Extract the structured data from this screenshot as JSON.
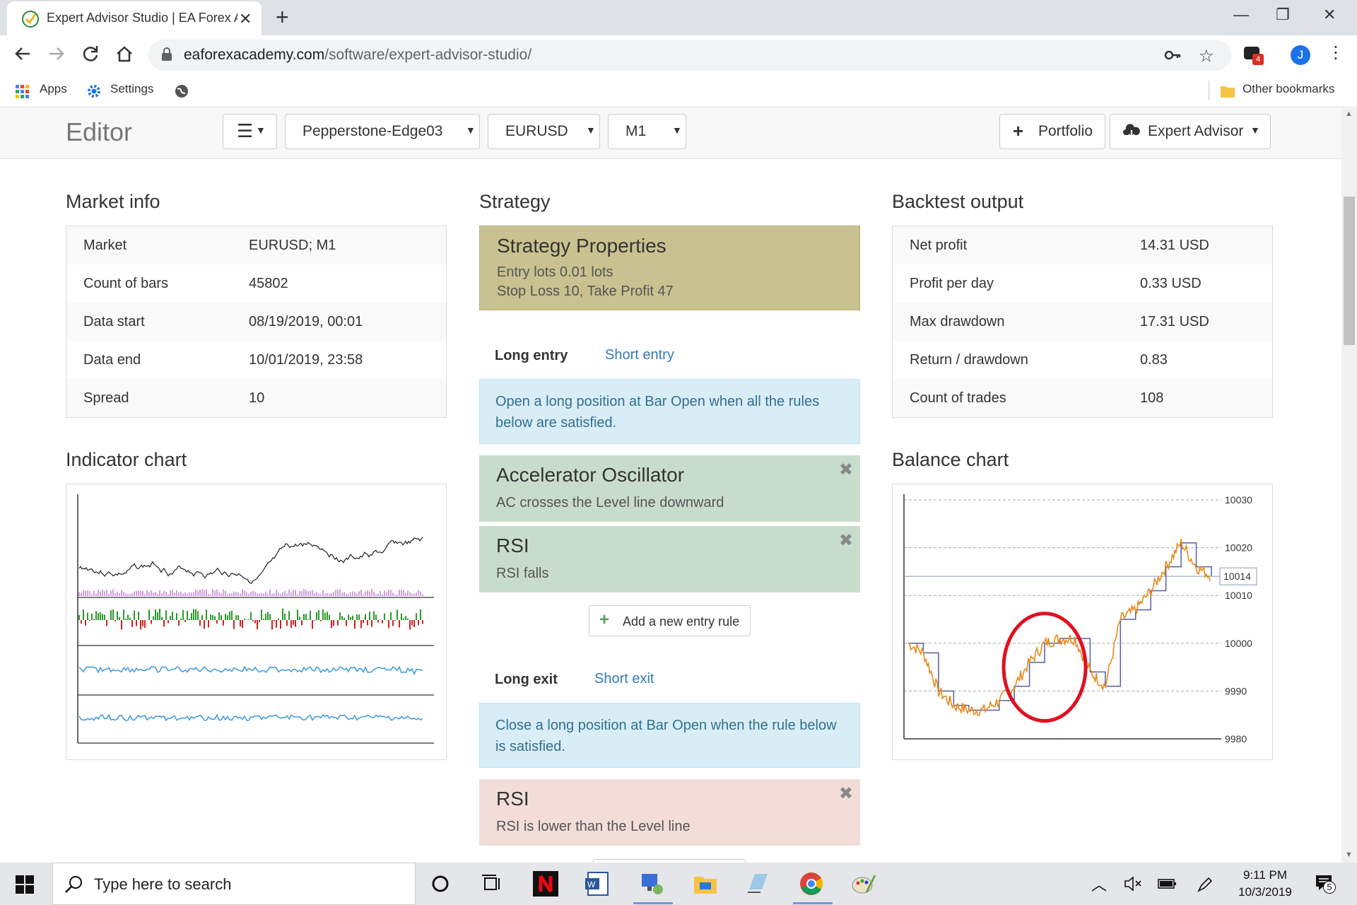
{
  "browser": {
    "tab_title": "Expert Advisor Studio | EA Forex A",
    "url_host": "eaforexacademy.com",
    "url_path": "/software/expert-advisor-studio/",
    "profile_initial": "J",
    "extension_badge": "4",
    "bookmarks": {
      "apps": "Apps",
      "settings": "Settings",
      "other": "Other bookmarks"
    }
  },
  "editor": {
    "title": "Editor",
    "menu_icon": "hamburger-icon",
    "server": "Pepperstone-Edge03",
    "symbol": "EURUSD",
    "period": "M1",
    "portfolio_label": "Portfolio",
    "expert_advisor_label": "Expert Advisor"
  },
  "market_info": {
    "title": "Market info",
    "rows": [
      {
        "key": "Market",
        "value": "EURUSD; M1"
      },
      {
        "key": "Count of bars",
        "value": "45802"
      },
      {
        "key": "Data start",
        "value": "08/19/2019, 00:01"
      },
      {
        "key": "Data end",
        "value": "10/01/2019, 23:58"
      },
      {
        "key": "Spread",
        "value": "10"
      }
    ]
  },
  "strategy": {
    "title": "Strategy",
    "properties": {
      "title": "Strategy Properties",
      "line1": "Entry lots 0.01 lots",
      "line2": "Stop Loss 10, Take Profit 47"
    },
    "entry_tabs": {
      "long": "Long entry",
      "short": "Short entry"
    },
    "entry_info": "Open a long position at Bar Open when all the rules below are satisfied.",
    "entry_rules": [
      {
        "title": "Accelerator Oscillator",
        "desc": "AC crosses the Level line downward"
      },
      {
        "title": "RSI",
        "desc": "RSI falls"
      }
    ],
    "add_entry_label": "Add a new entry rule",
    "exit_tabs": {
      "long": "Long exit",
      "short": "Short exit"
    },
    "exit_info": "Close a long position at Bar Open when the rule below is satisfied.",
    "exit_rules": [
      {
        "title": "RSI",
        "desc": "RSI is lower than the Level line"
      }
    ]
  },
  "backtest": {
    "title": "Backtest output",
    "rows": [
      {
        "key": "Net profit",
        "value": "14.31 USD"
      },
      {
        "key": "Profit per day",
        "value": "0.33 USD"
      },
      {
        "key": "Max drawdown",
        "value": "17.31 USD"
      },
      {
        "key": "Return / drawdown",
        "value": "0.83"
      },
      {
        "key": "Count of trades",
        "value": "108"
      }
    ]
  },
  "indicator_chart": {
    "title": "Indicator chart"
  },
  "chart_data": {
    "type": "line",
    "title": "Balance chart",
    "y_ticks": [
      "10030",
      "10020",
      "10010",
      "10000",
      "9990",
      "9980"
    ],
    "ylim": [
      9980,
      10030
    ],
    "current_value": "10014",
    "x": [
      0,
      5,
      10,
      15,
      20,
      25,
      30,
      35,
      40,
      45,
      50,
      55,
      60,
      65,
      70,
      75,
      80,
      85,
      90,
      95,
      100
    ],
    "series": [
      {
        "values": [
          10000,
          9998,
          9990,
          9987,
          9986,
          9986,
          9988,
          9991,
          9996,
          10000,
          10001,
          10001,
          9994,
          9991,
          10005,
          10007,
          10011,
          10016,
          10021,
          10016,
          10014
        ]
      }
    ],
    "colors": {
      "line": "#e8891a",
      "step": "#5560a0",
      "annotation": "#e01020"
    }
  },
  "taskbar": {
    "search_placeholder": "Type here to search",
    "time": "9:11 PM",
    "date": "10/3/2019",
    "notification_count": "5"
  }
}
